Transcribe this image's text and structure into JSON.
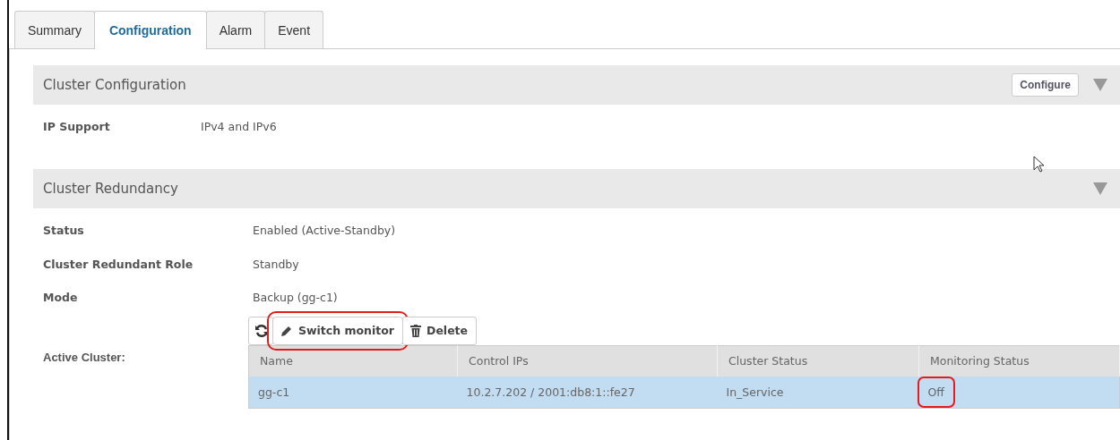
{
  "tabs": [
    {
      "label": "Summary",
      "selected": false
    },
    {
      "label": "Configuration",
      "selected": true
    },
    {
      "label": "Alarm",
      "selected": false
    },
    {
      "label": "Event",
      "selected": false
    }
  ],
  "sections": [
    {
      "title": "Cluster Configuration",
      "action": "Configure",
      "expanded": true,
      "rows": [
        {
          "label": "IP Support",
          "value": "IPv4 and IPv6"
        }
      ]
    },
    {
      "title": "Cluster Redundancy",
      "expanded": true,
      "rows": [
        {
          "label": "Status",
          "value": "Enabled (Active-Standby)"
        },
        {
          "label": "Cluster Redundant Role",
          "value": "Standby"
        },
        {
          "label": "Mode",
          "value": "Backup (gg-c1)"
        }
      ],
      "active_cluster": {
        "label": "Active Cluster:",
        "toolbar": [
          {
            "kind": "refresh",
            "highlighted": false
          },
          {
            "kind": "edit",
            "label": "Switch monitor",
            "highlighted": true
          },
          {
            "kind": "delete",
            "label": "Delete",
            "highlighted": false
          }
        ],
        "table": {
          "columns": [
            "Name",
            "Control IPs",
            "Cluster Status",
            "Monitoring Status"
          ],
          "rows": [
            {
              "selected": true,
              "cells": [
                {
                  "text": "gg-c1"
                },
                {
                  "text": "10.2.7.202 / 2001:db8:1::fe27"
                },
                {
                  "text": "In_Service"
                },
                {
                  "text": "Off",
                  "highlighted": true
                }
              ]
            }
          ]
        }
      }
    }
  ]
}
